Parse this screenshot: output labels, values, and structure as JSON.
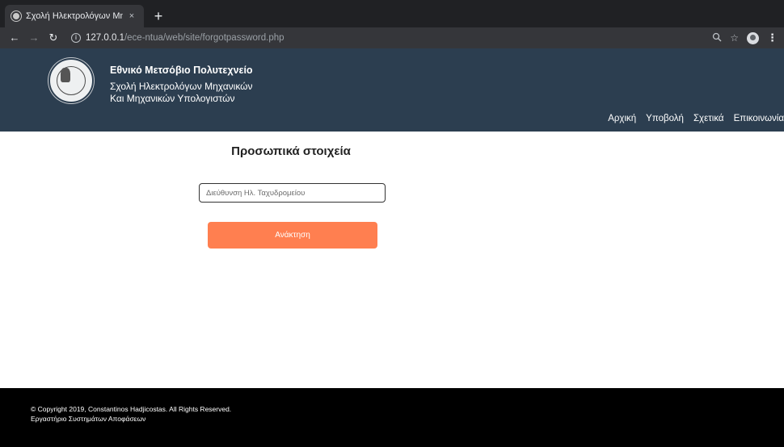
{
  "browser": {
    "tab_title": "Σχολή Ηλεκτρολόγων Μηχανικ",
    "tab_close": "×",
    "new_tab": "+",
    "url_host": "127.0.0.1",
    "url_path": "/ece-ntua/web/site/forgotpassword.php",
    "icons": {
      "back": "back-arrow-icon",
      "forward": "forward-arrow-icon",
      "reload": "reload-icon",
      "info": "info-icon",
      "zoom": "zoom-icon",
      "bookmark": "star-icon",
      "profile": "avatar-icon",
      "menu": "more-vertical-icon"
    }
  },
  "header": {
    "university": "Εθνικό Μετσόβιο Πολυτεχνείο",
    "school_line1": "Σχολή Ηλεκτρολόγων Μηχανικών",
    "school_line2": "Και Μηχανικών Υπολογιστών",
    "nav": [
      {
        "label": "Αρχική"
      },
      {
        "label": "Υποβολή"
      },
      {
        "label": "Σχετικά"
      },
      {
        "label": "Επικοινωνία"
      }
    ],
    "background_color": "#2c3e50"
  },
  "main": {
    "title": "Προσωπικά στοιχεία",
    "email_placeholder": "Διεύθυνση Ηλ. Ταχυδρομείου",
    "email_value": "",
    "submit_label": "Ανάκτηση",
    "button_color": "#ff7f50"
  },
  "footer": {
    "copyright": "© Copyright 2019, Constantinos Hadjicostas. All Rights Reserved.",
    "lab": "Εργαστήριο Συστημάτων Αποφάσεων"
  }
}
